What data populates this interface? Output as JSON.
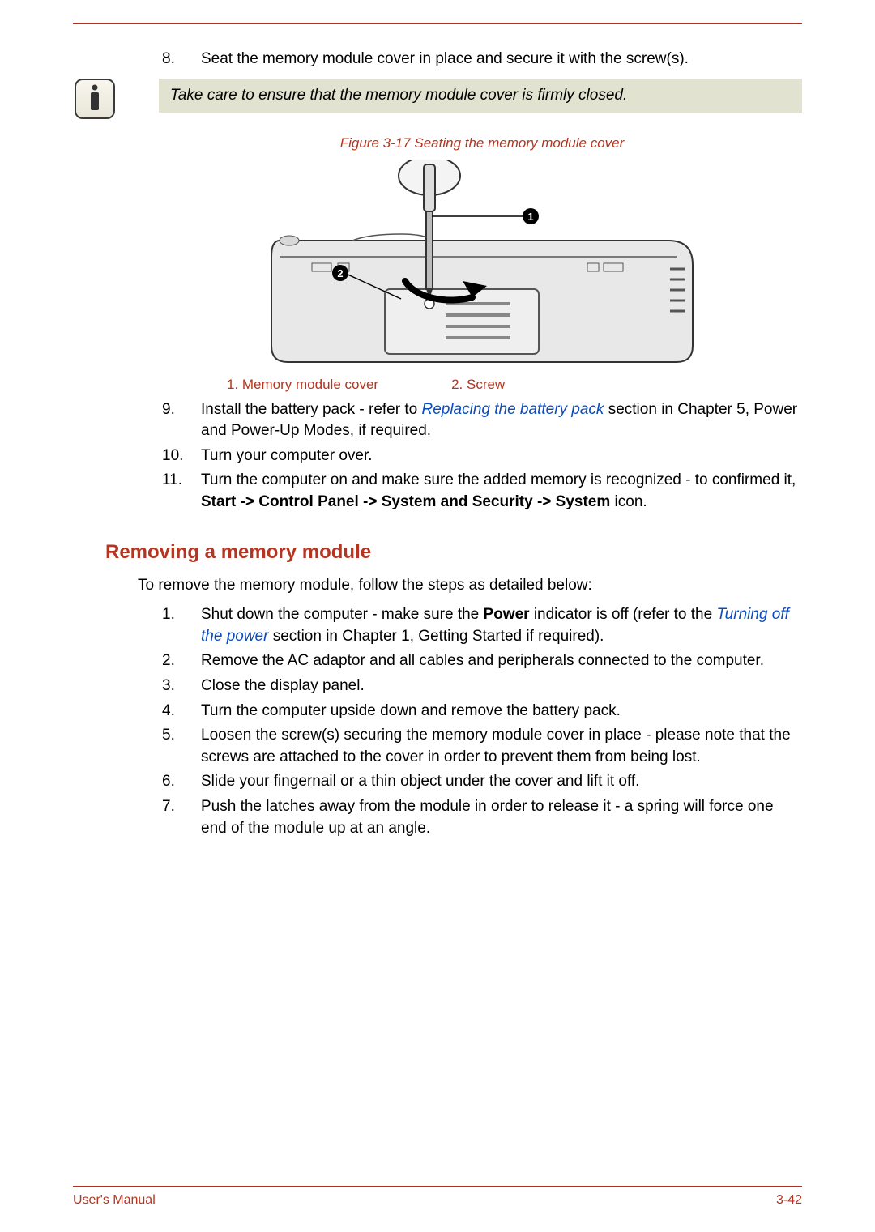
{
  "step8": {
    "num": "8.",
    "text": "Seat the memory module cover in place and secure it with the screw(s)."
  },
  "note": "Take care to ensure that the memory module cover is firmly closed.",
  "figure": {
    "caption": "Figure 3-17 Seating the memory module cover",
    "callouts": {
      "one": "1",
      "two": "2"
    },
    "legend1": "1. Memory module cover",
    "legend2": "2. Screw"
  },
  "step9": {
    "num": "9.",
    "pre": "Install the battery pack - refer to ",
    "link": "Replacing the battery pack",
    "post": " section in Chapter 5, Power and Power-Up Modes, if required."
  },
  "step10": {
    "num": "10.",
    "text": "Turn your computer over."
  },
  "step11": {
    "num": "11.",
    "pre": "Turn the computer on and make sure the added memory is recognized - to confirmed it, ",
    "bold": "Start -> Control Panel -> System and Security -> System",
    "post": " icon."
  },
  "heading": "Removing a memory module",
  "intro": "To remove the memory module, follow the steps as detailed below:",
  "r1": {
    "num": "1.",
    "pre": "Shut down the computer - make sure the ",
    "bold": "Power",
    "mid": " indicator is off (refer to the ",
    "link": "Turning off the power",
    "post": " section in Chapter 1, Getting Started if required)."
  },
  "r2": {
    "num": "2.",
    "text": "Remove the AC adaptor and all cables and peripherals connected to the computer."
  },
  "r3": {
    "num": "3.",
    "text": "Close the display panel."
  },
  "r4": {
    "num": "4.",
    "text": "Turn the computer upside down and remove the battery pack."
  },
  "r5": {
    "num": "5.",
    "text": "Loosen the screw(s) securing the memory module cover in place - please note that the screws are attached to the cover in order to prevent them from being lost."
  },
  "r6": {
    "num": "6.",
    "text": "Slide your fingernail or a thin object under the cover and lift it off."
  },
  "r7": {
    "num": "7.",
    "text": "Push the latches away from the module in order to release it - a spring will force one end of the module up at an angle."
  },
  "footer": {
    "left": "User's Manual",
    "right": "3-42"
  }
}
